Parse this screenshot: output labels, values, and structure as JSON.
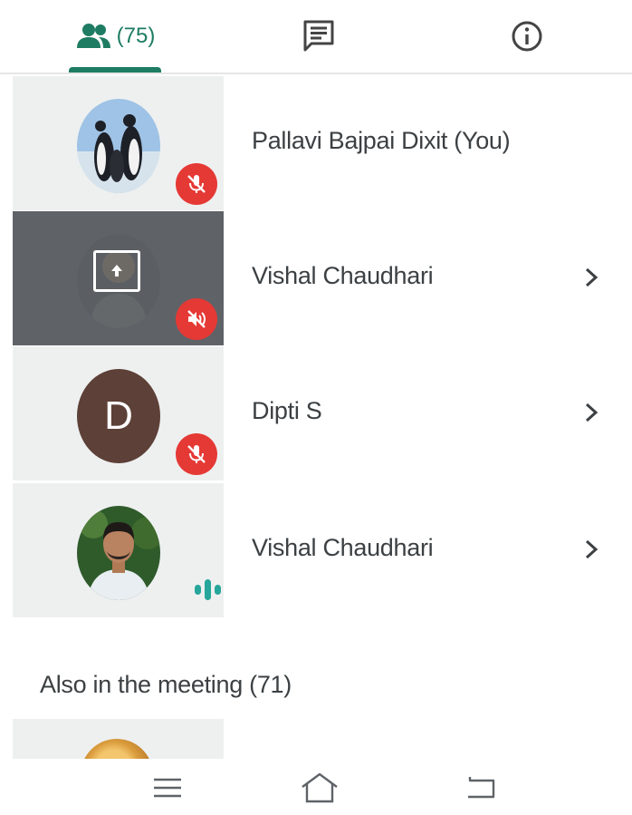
{
  "tabs": {
    "people": {
      "icon": "people-icon",
      "count": "(75)",
      "selected": true
    },
    "chat": {
      "icon": "chat-icon"
    },
    "info": {
      "icon": "info-icon"
    }
  },
  "colors": {
    "accent": "#1e7c63",
    "muted_badge": "#e53935",
    "tile_bg": "#eef0f0",
    "presenting_tile_bg": "#5f6368"
  },
  "participants": [
    {
      "name": "Pallavi Bajpai Dixit (You)",
      "avatar": "penguin-photo",
      "status": "mic-muted",
      "chevron": false
    },
    {
      "name": "Vishal Chaudhari",
      "avatar": "presenting",
      "status": "volume-muted",
      "chevron": true
    },
    {
      "name": "Dipti S",
      "avatar_letter": "D",
      "avatar_color": "#5d4037",
      "status": "mic-muted",
      "chevron": true
    },
    {
      "name": "Vishal Chaudhari",
      "avatar": "person-photo",
      "status": "speaking",
      "chevron": true
    }
  ],
  "also_in_meeting": {
    "title": "Also in the meeting (71)"
  },
  "nav": {
    "icons": [
      "menu-icon",
      "home-icon",
      "back-icon"
    ]
  }
}
